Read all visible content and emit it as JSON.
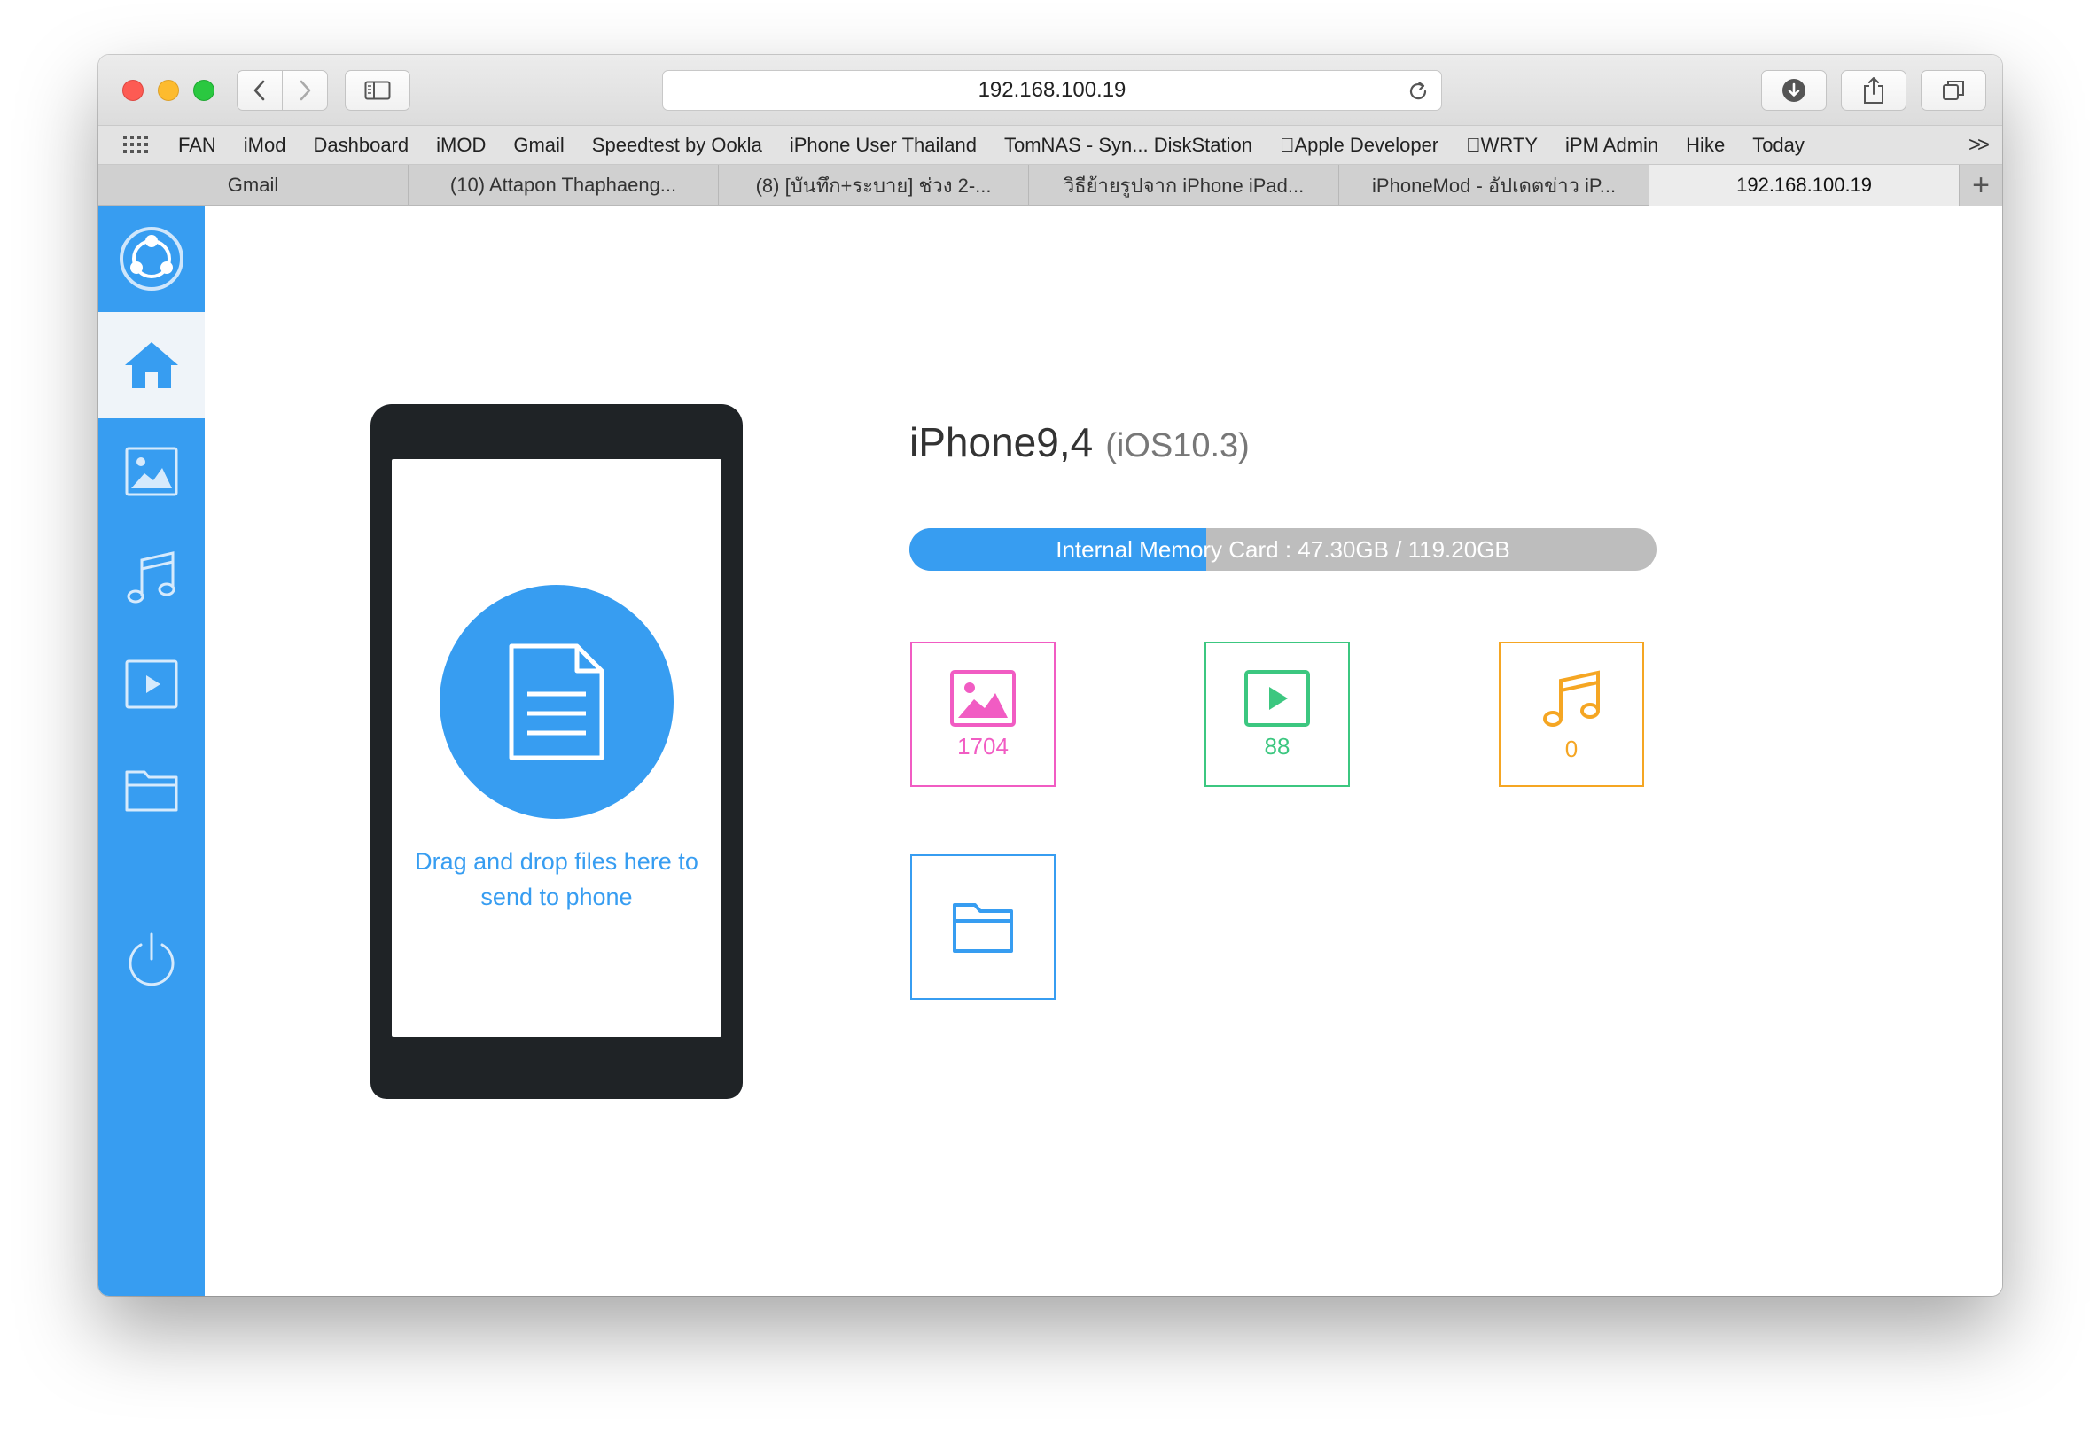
{
  "browser": {
    "address": "192.168.100.19",
    "bookmarks": [
      "FAN",
      "iMod",
      "Dashboard",
      "iMOD",
      "Gmail",
      "Speedtest by Ookla",
      "iPhone User Thailand",
      "TomNAS - Syn... DiskStation",
      "Apple Developer",
      "WRTY",
      "iPM Admin",
      "Hike",
      "Today"
    ],
    "bookmarks_more": ">>",
    "tabs": [
      {
        "label": "Gmail",
        "active": false
      },
      {
        "label": "(10) Attapon Thaphaeng...",
        "active": false
      },
      {
        "label": "(8) [บันทึก+ระบาย] ช่วง 2-...",
        "active": false
      },
      {
        "label": "วิธีย้ายรูปจาก iPhone iPad...",
        "active": false
      },
      {
        "label": "iPhoneMod - อัปเดตข่าว iP...",
        "active": false
      },
      {
        "label": "192.168.100.19",
        "active": true
      }
    ],
    "new_tab": "+"
  },
  "sidebar": {
    "items": [
      {
        "name": "app-logo-icon",
        "active": false
      },
      {
        "name": "home-icon",
        "active": true
      },
      {
        "name": "photos-icon",
        "active": false
      },
      {
        "name": "music-icon",
        "active": false
      },
      {
        "name": "video-icon",
        "active": false
      },
      {
        "name": "folder-icon",
        "active": false
      },
      {
        "name": "power-icon",
        "active": false
      }
    ]
  },
  "phone": {
    "drop_text": "Drag and drop files here to send to phone"
  },
  "device": {
    "name": "iPhone9,4",
    "os": "(iOS10.3)",
    "storage_label": "Internal Memory Card : 47.30GB / 119.20GB",
    "storage_used_fraction": 0.397
  },
  "categories": [
    {
      "name": "photos",
      "count": "1704",
      "color": "#f15cc3",
      "icon": "image-icon"
    },
    {
      "name": "videos",
      "count": "88",
      "color": "#3cc780",
      "icon": "play-icon"
    },
    {
      "name": "music",
      "count": "0",
      "color": "#f5a623",
      "icon": "music-icon"
    },
    {
      "name": "files",
      "count": "",
      "color": "#379df1",
      "icon": "folder-icon"
    }
  ],
  "colors": {
    "accent": "#379df1",
    "photos": "#f15cc3",
    "videos": "#3cc780",
    "music": "#f5a623"
  }
}
